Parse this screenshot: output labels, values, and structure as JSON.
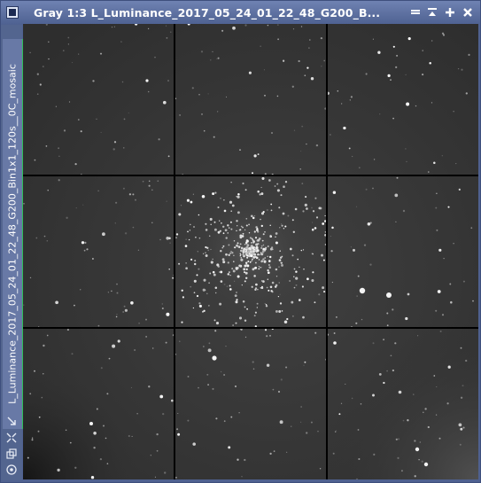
{
  "window": {
    "title": "Gray 1:3 L_Luminance_2017_05_24_01_22_48_G200_B...",
    "app_icon": "pixinsight-image-icon"
  },
  "title_buttons": [
    {
      "name": "shade-icon"
    },
    {
      "name": "minimize-icon"
    },
    {
      "name": "maximize-icon"
    },
    {
      "name": "close-icon"
    }
  ],
  "sidebar": {
    "image_id_tab": "L_Luminance_2017_05_24_01_22_48_G200_Bin1x1_120s__0C_mosaic",
    "accent_color": "#2fbf5a",
    "tools": [
      {
        "name": "fit-view-icon"
      },
      {
        "name": "zoom-fit-icon"
      },
      {
        "name": "clone-icon"
      },
      {
        "name": "stf-icon"
      }
    ]
  },
  "image": {
    "zoom": "1:3",
    "color_space": "Gray",
    "tiles_grid": "3x3"
  }
}
